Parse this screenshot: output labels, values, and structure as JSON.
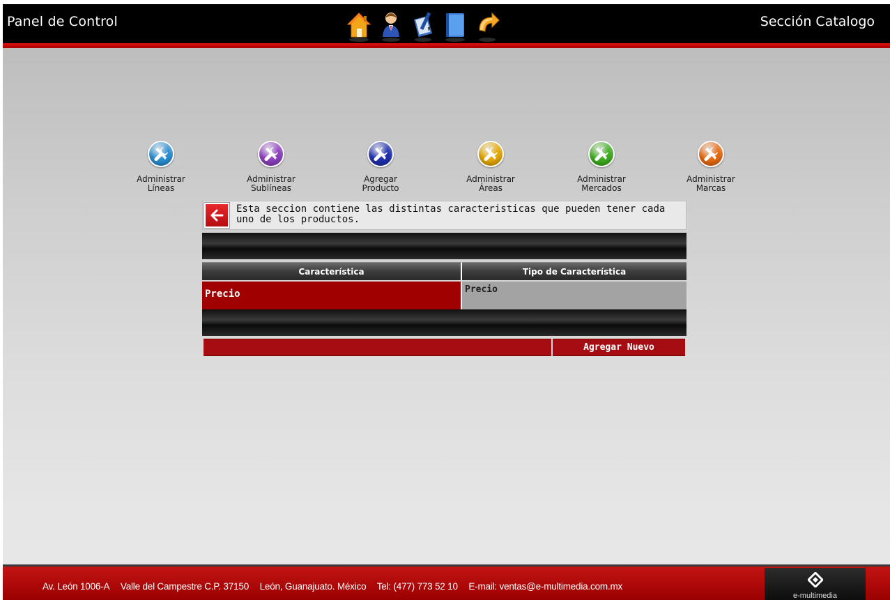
{
  "header": {
    "title": "Panel de Control",
    "section": "Sección Catalogo",
    "icons": [
      "home-icon",
      "user-icon",
      "pencil-book-icon",
      "notebook-icon",
      "refresh-arrow-icon"
    ]
  },
  "categories": [
    {
      "line1": "Administrar",
      "line2": "Líneas",
      "color": "#2a8fd4"
    },
    {
      "line1": "Administrar",
      "line2": "Sublíneas",
      "color": "#8d3fbf"
    },
    {
      "line1": "Agregar",
      "line2": "Producto",
      "color": "#1f2fb0"
    },
    {
      "line1": "Administrar",
      "line2": "Áreas",
      "color": "#e6a800"
    },
    {
      "line1": "Administrar",
      "line2": "Mercados",
      "color": "#3fae1f"
    },
    {
      "line1": "Administrar",
      "line2": "Marcas",
      "color": "#e86a0f"
    }
  ],
  "info": {
    "text": "Esta seccion contiene las distintas caracteristicas que pueden tener cada uno de los productos."
  },
  "table": {
    "headers": [
      "Característica",
      "Tipo de Característica"
    ],
    "rows": [
      {
        "caracteristica": "Precio",
        "tipo": "Precio"
      }
    ]
  },
  "actions": {
    "add_new": "Agregar Nuevo"
  },
  "footer": {
    "address": "Av. León 1006-A",
    "colony": "Valle del Campestre C.P. 37150",
    "city": "León, Guanajuato. México",
    "phone": "Tel: (477) 773 52 10",
    "email": "E-mail: ventas@e-multimedia.com.mx",
    "brand": "e-multimedia"
  },
  "colors": {
    "accent_red": "#a60d12",
    "header_bg": "#000000"
  }
}
